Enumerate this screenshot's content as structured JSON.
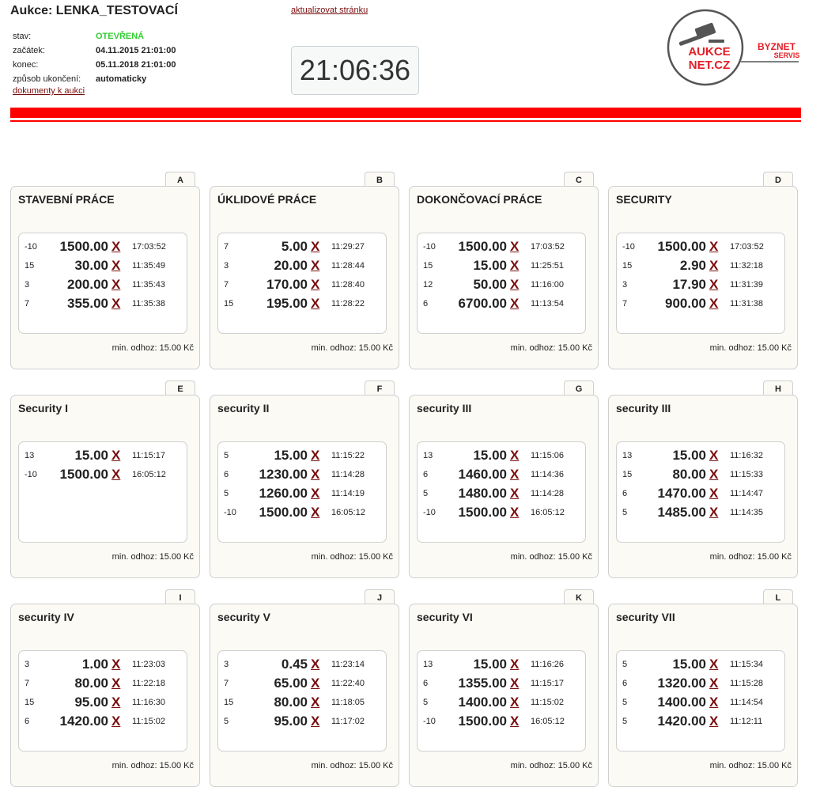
{
  "header": {
    "title": "Aukce: LENKA_TESTOVACÍ",
    "refresh_link": "aktualizovat stránku",
    "doc_link": "dokumenty k aukci",
    "clock": "21:06:36",
    "info": [
      {
        "key": "stav:",
        "value": "OTEVŘENÁ"
      },
      {
        "key": "začátek:",
        "value": "04.11.2015 21:01:00"
      },
      {
        "key": "konec:",
        "value": "05.11.2018 21:01:00"
      },
      {
        "key": "způsob ukončení:",
        "value": "automaticky"
      }
    ]
  },
  "logo": {
    "line1": "AUKCE",
    "line2": "NET.CZ",
    "side1": "BYZNET",
    "side2": "SERVIS"
  },
  "colors": {
    "accent_red": "#ff0000",
    "link": "#7a0d0d",
    "open_status": "#33cc33",
    "card_bg": "#fbfaf5"
  },
  "delete_symbol": "X",
  "lots": [
    {
      "letter": "A",
      "name": "STAVEBNÍ PRÁCE",
      "min_bid": "min. odhoz: 15.00 Kč",
      "bids": [
        {
          "n": "-10",
          "price": "1500.00",
          "time": "17:03:52"
        },
        {
          "n": "15",
          "price": "30.00",
          "time": "11:35:49"
        },
        {
          "n": "3",
          "price": "200.00",
          "time": "11:35:43"
        },
        {
          "n": "7",
          "price": "355.00",
          "time": "11:35:38"
        }
      ]
    },
    {
      "letter": "B",
      "name": "ÚKLIDOVÉ PRÁCE",
      "min_bid": "min. odhoz: 15.00 Kč",
      "bids": [
        {
          "n": "7",
          "price": "5.00",
          "time": "11:29:27"
        },
        {
          "n": "3",
          "price": "20.00",
          "time": "11:28:44"
        },
        {
          "n": "7",
          "price": "170.00",
          "time": "11:28:40"
        },
        {
          "n": "15",
          "price": "195.00",
          "time": "11:28:22"
        }
      ]
    },
    {
      "letter": "C",
      "name": "DOKONČOVACÍ PRÁCE",
      "min_bid": "min. odhoz: 15.00 Kč",
      "bids": [
        {
          "n": "-10",
          "price": "1500.00",
          "time": "17:03:52"
        },
        {
          "n": "15",
          "price": "15.00",
          "time": "11:25:51"
        },
        {
          "n": "12",
          "price": "50.00",
          "time": "11:16:00"
        },
        {
          "n": "6",
          "price": "6700.00",
          "time": "11:13:54"
        }
      ]
    },
    {
      "letter": "D",
      "name": "SECURITY",
      "min_bid": "min. odhoz: 15.00 Kč",
      "bids": [
        {
          "n": "-10",
          "price": "1500.00",
          "time": "17:03:52"
        },
        {
          "n": "15",
          "price": "2.90",
          "time": "11:32:18"
        },
        {
          "n": "3",
          "price": "17.90",
          "time": "11:31:39"
        },
        {
          "n": "7",
          "price": "900.00",
          "time": "11:31:38"
        }
      ]
    },
    {
      "letter": "E",
      "name": "Security I",
      "min_bid": "min. odhoz: 15.00 Kč",
      "bids": [
        {
          "n": "13",
          "price": "15.00",
          "time": "11:15:17"
        },
        {
          "n": "-10",
          "price": "1500.00",
          "time": "16:05:12"
        }
      ]
    },
    {
      "letter": "F",
      "name": "security II",
      "min_bid": "min. odhoz: 15.00 Kč",
      "bids": [
        {
          "n": "5",
          "price": "15.00",
          "time": "11:15:22"
        },
        {
          "n": "6",
          "price": "1230.00",
          "time": "11:14:28"
        },
        {
          "n": "5",
          "price": "1260.00",
          "time": "11:14:19"
        },
        {
          "n": "-10",
          "price": "1500.00",
          "time": "16:05:12"
        }
      ]
    },
    {
      "letter": "G",
      "name": "security III",
      "min_bid": "min. odhoz: 15.00 Kč",
      "bids": [
        {
          "n": "13",
          "price": "15.00",
          "time": "11:15:06"
        },
        {
          "n": "6",
          "price": "1460.00",
          "time": "11:14:36"
        },
        {
          "n": "5",
          "price": "1480.00",
          "time": "11:14:28"
        },
        {
          "n": "-10",
          "price": "1500.00",
          "time": "16:05:12"
        }
      ]
    },
    {
      "letter": "H",
      "name": "security III",
      "min_bid": "min. odhoz: 15.00 Kč",
      "bids": [
        {
          "n": "13",
          "price": "15.00",
          "time": "11:16:32"
        },
        {
          "n": "15",
          "price": "80.00",
          "time": "11:15:33"
        },
        {
          "n": "6",
          "price": "1470.00",
          "time": "11:14:47"
        },
        {
          "n": "5",
          "price": "1485.00",
          "time": "11:14:35"
        }
      ]
    },
    {
      "letter": "I",
      "name": "security IV",
      "min_bid": "min. odhoz: 15.00 Kč",
      "bids": [
        {
          "n": "3",
          "price": "1.00",
          "time": "11:23:03"
        },
        {
          "n": "7",
          "price": "80.00",
          "time": "11:22:18"
        },
        {
          "n": "15",
          "price": "95.00",
          "time": "11:16:30"
        },
        {
          "n": "6",
          "price": "1420.00",
          "time": "11:15:02"
        }
      ]
    },
    {
      "letter": "J",
      "name": "security V",
      "min_bid": "min. odhoz: 15.00 Kč",
      "bids": [
        {
          "n": "3",
          "price": "0.45",
          "time": "11:23:14"
        },
        {
          "n": "7",
          "price": "65.00",
          "time": "11:22:40"
        },
        {
          "n": "15",
          "price": "80.00",
          "time": "11:18:05"
        },
        {
          "n": "5",
          "price": "95.00",
          "time": "11:17:02"
        }
      ]
    },
    {
      "letter": "K",
      "name": "security VI",
      "min_bid": "min. odhoz: 15.00 Kč",
      "bids": [
        {
          "n": "13",
          "price": "15.00",
          "time": "11:16:26"
        },
        {
          "n": "6",
          "price": "1355.00",
          "time": "11:15:17"
        },
        {
          "n": "5",
          "price": "1400.00",
          "time": "11:15:02"
        },
        {
          "n": "-10",
          "price": "1500.00",
          "time": "16:05:12"
        }
      ]
    },
    {
      "letter": "L",
      "name": "security VII",
      "min_bid": "min. odhoz: 15.00 Kč",
      "bids": [
        {
          "n": "5",
          "price": "15.00",
          "time": "11:15:34"
        },
        {
          "n": "6",
          "price": "1320.00",
          "time": "11:15:28"
        },
        {
          "n": "5",
          "price": "1400.00",
          "time": "11:14:54"
        },
        {
          "n": "5",
          "price": "1420.00",
          "time": "11:12:11"
        }
      ]
    }
  ]
}
